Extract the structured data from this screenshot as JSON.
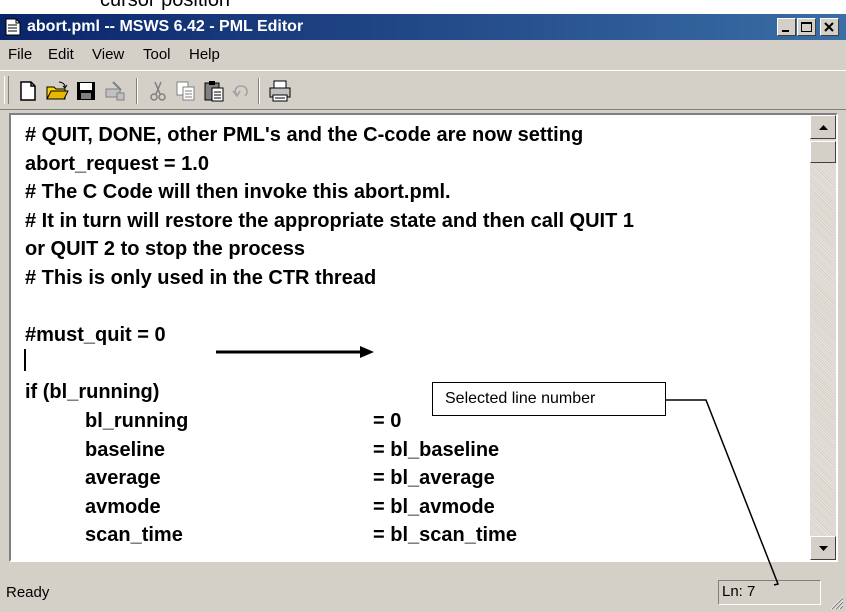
{
  "caption": "cursor position",
  "window": {
    "title": "abort.pml -- MSWS 6.42 - PML Editor",
    "controls": {
      "minimize": "minimize-icon",
      "maximize": "maximize-icon",
      "close": "close-icon"
    }
  },
  "menu": {
    "file": "File",
    "edit": "Edit",
    "view": "View",
    "tool": "Tool",
    "help": "Help"
  },
  "toolbar": [
    "new-icon",
    "open-icon",
    "save-icon",
    "print-setup-icon",
    "cut-icon",
    "copy-icon",
    "paste-icon",
    "undo-icon",
    "print-icon"
  ],
  "editor": {
    "lines": [
      "# QUIT, DONE, other PML's and the C-code are now setting",
      "abort_request = 1.0",
      "# The C Code will then invoke this abort.pml.",
      "# It in turn will restore the appropriate state and then call QUIT 1",
      "or QUIT 2 to stop the process",
      "# This is only used in the CTR thread",
      "",
      "#must_quit = 0",
      "",
      "if (bl_running)"
    ],
    "assignments": [
      {
        "name": "bl_running",
        "value": "= 0"
      },
      {
        "name": "baseline",
        "value": "= bl_baseline"
      },
      {
        "name": "average",
        "value": "= bl_average"
      },
      {
        "name": "avmode",
        "value": "= bl_avmode"
      },
      {
        "name": "scan_time",
        "value": "= bl_scan_time"
      }
    ]
  },
  "status": {
    "text": "Ready",
    "line": "Ln: 7"
  },
  "annotation": {
    "callout": "Selected line number"
  }
}
